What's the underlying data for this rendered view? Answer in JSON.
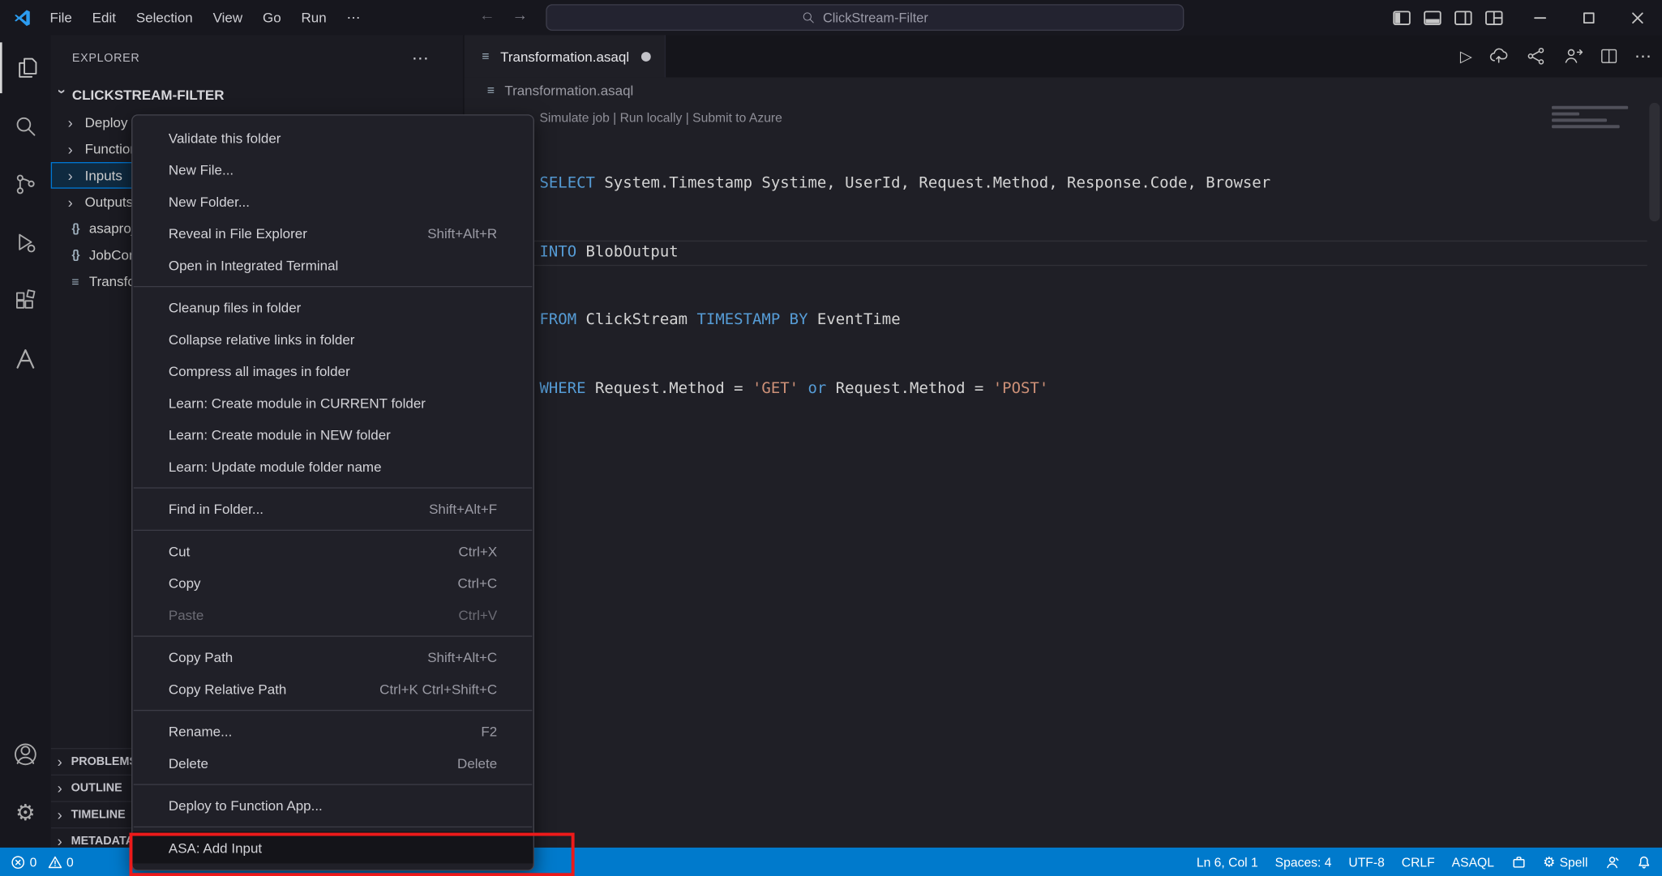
{
  "titlebar": {
    "menus": [
      "File",
      "Edit",
      "Selection",
      "View",
      "Go",
      "Run"
    ],
    "search": "ClickStream-Filter"
  },
  "explorer": {
    "title": "EXPLORER",
    "root": "CLICKSTREAM-FILTER",
    "items": [
      {
        "label": "Deploy",
        "type": "folder"
      },
      {
        "label": "Functions",
        "type": "folder"
      },
      {
        "label": "Inputs",
        "type": "folder",
        "selected": true
      },
      {
        "label": "Outputs",
        "type": "folder"
      },
      {
        "label": "asaproj.json",
        "type": "json"
      },
      {
        "label": "JobConfig.json",
        "type": "json"
      },
      {
        "label": "Transformation.asaql",
        "type": "file"
      }
    ],
    "panels": [
      "PROBLEMS",
      "OUTLINE",
      "TIMELINE",
      "METADATA"
    ]
  },
  "context_menu": {
    "items": [
      {
        "label": "Validate this folder"
      },
      {
        "label": "New File..."
      },
      {
        "label": "New Folder..."
      },
      {
        "label": "Reveal in File Explorer",
        "shortcut": "Shift+Alt+R"
      },
      {
        "label": "Open in Integrated Terminal"
      },
      {
        "label": "Cleanup files in folder"
      },
      {
        "label": "Collapse relative links in folder"
      },
      {
        "label": "Compress all images in folder"
      },
      {
        "label": "Learn: Create module in CURRENT folder"
      },
      {
        "label": "Learn: Create module in NEW folder"
      },
      {
        "label": "Learn: Update module folder name"
      },
      {
        "label": "Find in Folder...",
        "shortcut": "Shift+Alt+F"
      },
      {
        "label": "Cut",
        "shortcut": "Ctrl+X"
      },
      {
        "label": "Copy",
        "shortcut": "Ctrl+C"
      },
      {
        "label": "Paste",
        "shortcut": "Ctrl+V",
        "disabled": true
      },
      {
        "label": "Copy Path",
        "shortcut": "Shift+Alt+C"
      },
      {
        "label": "Copy Relative Path",
        "shortcut": "Ctrl+K Ctrl+Shift+C"
      },
      {
        "label": "Rename...",
        "shortcut": "F2"
      },
      {
        "label": "Delete",
        "shortcut": "Delete"
      },
      {
        "label": "Deploy to Function App..."
      },
      {
        "label": "ASA: Add Input",
        "highlighted": true
      }
    ]
  },
  "editor": {
    "tab": {
      "label": "Transformation.asaql",
      "dirty": true
    },
    "breadcrumb": "Transformation.asaql"
  },
  "code": {
    "codelens": "Simulate job | Run locally | Submit to Azure",
    "lines": [
      {
        "tokens": [
          {
            "c": "kw",
            "t": "SELECT"
          },
          {
            "c": "pl",
            "t": " System.Timestamp Systime, UserId, Request.Method, Response.Code, Browser"
          }
        ]
      },
      {
        "tokens": [
          {
            "c": "kw",
            "t": "INTO"
          },
          {
            "c": "pl",
            "t": " BlobOutput"
          }
        ]
      },
      {
        "tokens": [
          {
            "c": "kw",
            "t": "FROM"
          },
          {
            "c": "pl",
            "t": " ClickStream "
          },
          {
            "c": "kw",
            "t": "TIMESTAMP"
          },
          {
            "c": "pl",
            "t": " "
          },
          {
            "c": "kw",
            "t": "BY"
          },
          {
            "c": "pl",
            "t": " EventTime"
          }
        ]
      },
      {
        "tokens": [
          {
            "c": "kw",
            "t": "WHERE"
          },
          {
            "c": "pl",
            "t": " Request.Method = "
          },
          {
            "c": "str",
            "t": "'GET'"
          },
          {
            "c": "pl",
            "t": " "
          },
          {
            "c": "kw",
            "t": "or"
          },
          {
            "c": "pl",
            "t": " Request.Method = "
          },
          {
            "c": "str",
            "t": "'POST'"
          }
        ]
      }
    ]
  },
  "status_bar": {
    "errors": "0",
    "warnings": "0",
    "cursor": "Ln 6, Col 1",
    "indent": "Spaces: 4",
    "encoding": "UTF-8",
    "eol": "CRLF",
    "language": "ASAQL",
    "spell": "Spell"
  },
  "icons": {
    "activity_bar": [
      "explorer-icon",
      "search-icon",
      "source-control-icon",
      "run-debug-icon",
      "extensions-icon",
      "azure-icon",
      "account-icon",
      "settings-gear-icon"
    ],
    "editor_actions": [
      "run-query-icon",
      "cloud-upload-icon",
      "hierarchy-icon",
      "live-share-icon",
      "split-editor-icon",
      "more-actions-icon"
    ],
    "statusbar": [
      "error-icon",
      "warning-icon",
      "extension-icon",
      "spell-icon",
      "person-icon",
      "bell-icon"
    ]
  },
  "colors": {
    "status_bar": "#007acc",
    "selection_border": "#0078d4",
    "keyword": "#569cd6",
    "string": "#ce9178",
    "annotation": "#ec1a1a"
  }
}
